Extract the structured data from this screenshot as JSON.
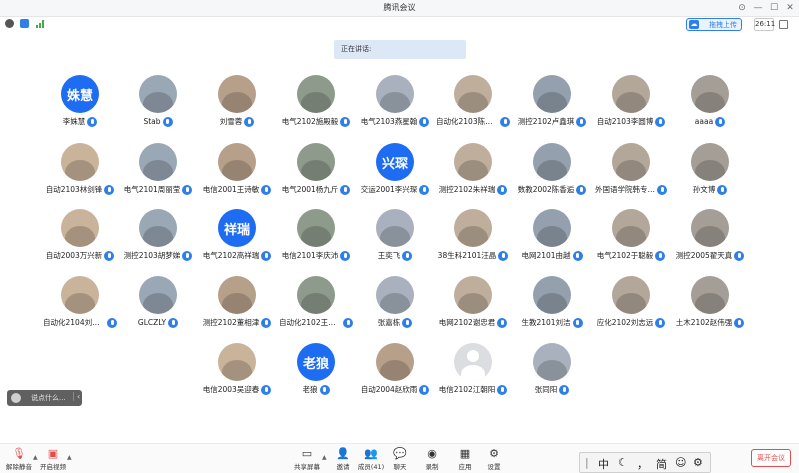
{
  "window": {
    "title": "腾讯会议"
  },
  "status": {
    "upload_label": "拖拽上传",
    "timer": "26:11"
  },
  "speaking": {
    "label": "正在讲话:"
  },
  "participants": [
    {
      "name": "李姝慧",
      "avatar_text": "姝慧",
      "avatar_color": "#1d6cf2"
    },
    {
      "name": "Stab",
      "avatar_text": ""
    },
    {
      "name": "刘雪蓉",
      "avatar_text": ""
    },
    {
      "name": "电气2102施殿毅",
      "avatar_text": ""
    },
    {
      "name": "电气2103燕星翰",
      "avatar_text": ""
    },
    {
      "name": "自动化2103陈志…",
      "avatar_text": ""
    },
    {
      "name": "测控2102卢鑫琪",
      "avatar_text": ""
    },
    {
      "name": "自动2103李圆博",
      "avatar_text": ""
    },
    {
      "name": "aaaa",
      "avatar_text": ""
    },
    {
      "name": "自动2103林剑锋",
      "avatar_text": ""
    },
    {
      "name": "电气2101周丽莹",
      "avatar_text": ""
    },
    {
      "name": "电信2001王诗敏",
      "avatar_text": ""
    },
    {
      "name": "电气2001杨九斤",
      "avatar_text": ""
    },
    {
      "name": "交运2001李兴琛",
      "avatar_text": "兴琛",
      "avatar_color": "#1d6cf2"
    },
    {
      "name": "测控2102朱祥瑞",
      "avatar_text": ""
    },
    {
      "name": "数教2002陈香逅",
      "avatar_text": ""
    },
    {
      "name": "外国语学院韩专…",
      "avatar_text": ""
    },
    {
      "name": "孙文博",
      "avatar_text": ""
    },
    {
      "name": "自动2003万兴新",
      "avatar_text": ""
    },
    {
      "name": "测控2103胡梦娣",
      "avatar_text": ""
    },
    {
      "name": "电气2102高祥瑞",
      "avatar_text": "祥瑞",
      "avatar_color": "#1d6cf2"
    },
    {
      "name": "电信2101李庆沛",
      "avatar_text": ""
    },
    {
      "name": "王奕飞",
      "avatar_text": ""
    },
    {
      "name": "38生科2101汪晶",
      "avatar_text": ""
    },
    {
      "name": "电网2101由越",
      "avatar_text": ""
    },
    {
      "name": "电气2102于聪毅",
      "avatar_text": ""
    },
    {
      "name": "测控2005翟天真",
      "avatar_text": ""
    },
    {
      "name": "自动化2104刘志…",
      "avatar_text": ""
    },
    {
      "name": "GLCZLY",
      "avatar_text": ""
    },
    {
      "name": "测控2102董相津",
      "avatar_text": ""
    },
    {
      "name": "自动化2102王俊…",
      "avatar_text": ""
    },
    {
      "name": "张嘉栋",
      "avatar_text": ""
    },
    {
      "name": "电网2102谢忠君",
      "avatar_text": ""
    },
    {
      "name": "生教2101刘洁",
      "avatar_text": ""
    },
    {
      "name": "应化2102刘志远",
      "avatar_text": ""
    },
    {
      "name": "土木2102赵伟强",
      "avatar_text": ""
    },
    {
      "name": "电信2003吴迎春",
      "avatar_text": ""
    },
    {
      "name": "老狼",
      "avatar_text": "老狼",
      "avatar_color": "#1d6cf2"
    },
    {
      "name": "自动2004赵欣雨",
      "avatar_text": ""
    },
    {
      "name": "电信2102江朝阳",
      "avatar_text": ""
    },
    {
      "name": "张同阳",
      "avatar_text": ""
    }
  ],
  "chat": {
    "placeholder": "说点什么..."
  },
  "toolbar": {
    "mute": "解除静音",
    "video": "开启视频",
    "share": "共享屏幕",
    "invite": "邀请",
    "members": "成员(41)",
    "chat": "聊天",
    "record": "录制",
    "apps": "应用",
    "settings": "设置",
    "leave": "离开会议"
  },
  "ime": {
    "mode": "中",
    "punct": "，",
    "simplified": "简"
  }
}
